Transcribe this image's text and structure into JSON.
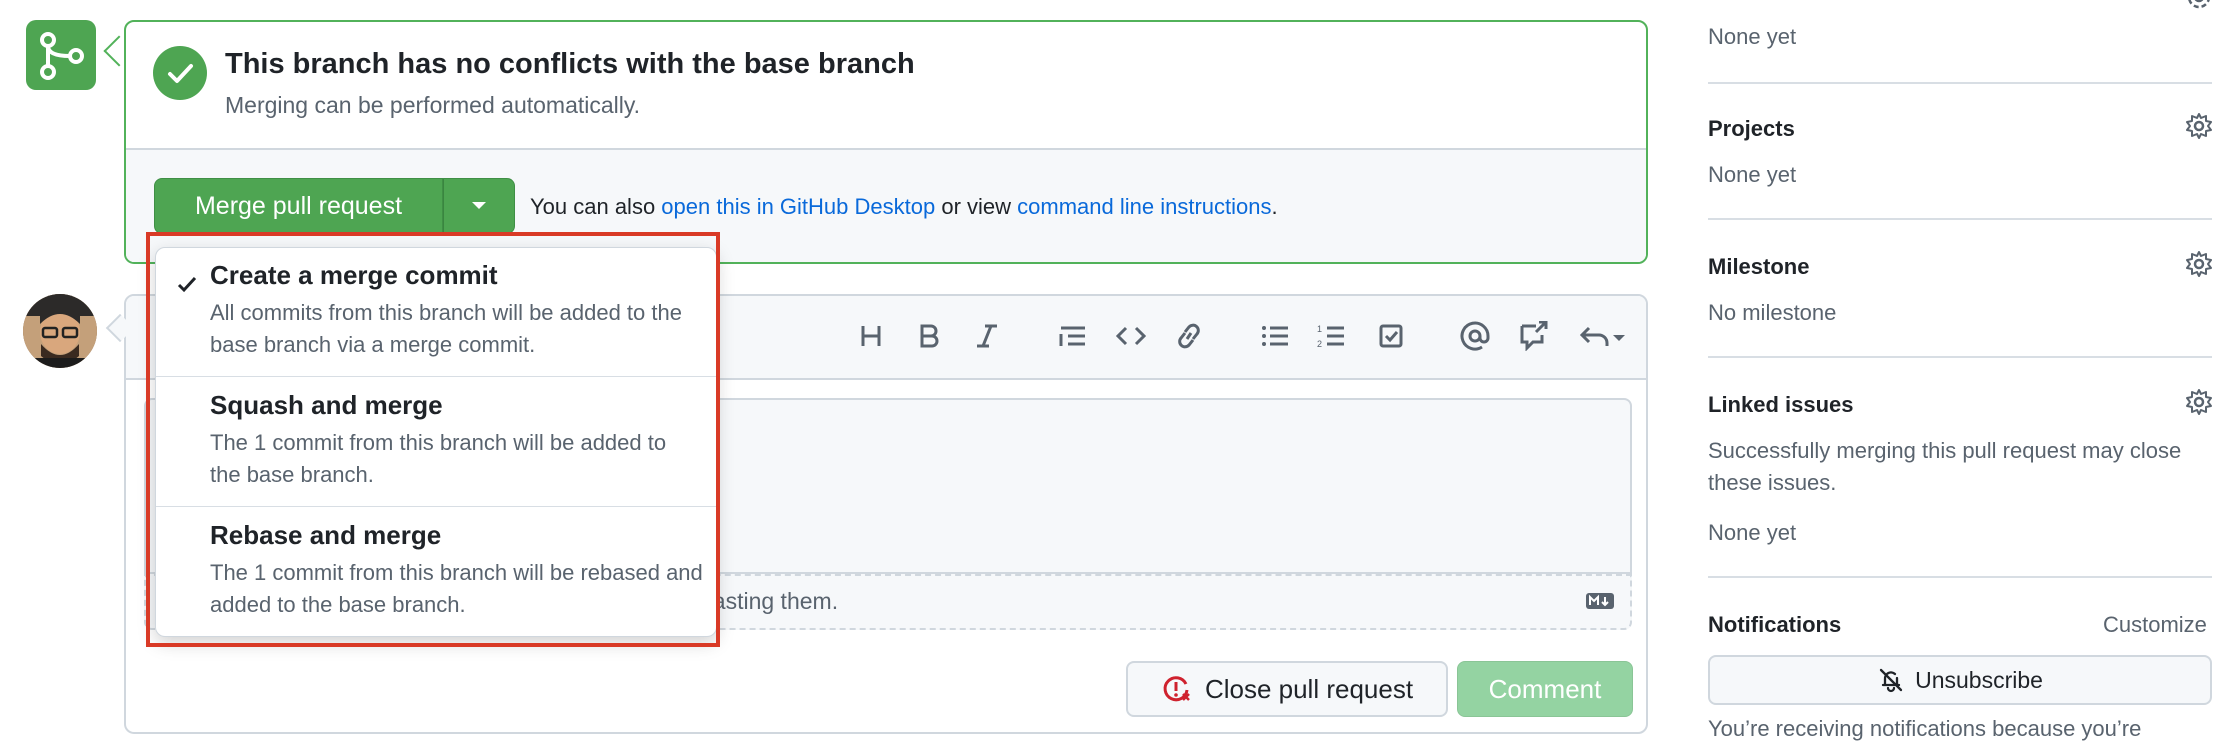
{
  "merge_status": {
    "title": "This branch has no conflicts with the base branch",
    "subtitle": "Merging can be performed automatically."
  },
  "merge_actions": {
    "merge_button_label": "Merge pull request",
    "also_prefix": "You can also ",
    "desktop_link": "open this in GitHub Desktop",
    "or_view": " or view ",
    "cli_link": "command line instructions",
    "period": "."
  },
  "merge_options": [
    {
      "title": "Create a merge commit",
      "desc": "All commits from this branch will be added to the base branch via a merge commit.",
      "selected": true
    },
    {
      "title": "Squash and merge",
      "desc": "The 1 commit from this branch will be added to the base branch.",
      "selected": false
    },
    {
      "title": "Rebase and merge",
      "desc": "The 1 commit from this branch will be rebased and added to the base branch.",
      "selected": false
    }
  ],
  "comment": {
    "attach_hint_partial": "pasting them.",
    "close_pr_label": "Close pull request",
    "comment_label": "Comment"
  },
  "sidebar": {
    "top_value": "None yet",
    "projects": {
      "label": "Projects",
      "value": "None yet"
    },
    "milestone": {
      "label": "Milestone",
      "value": "No milestone"
    },
    "linked_issues": {
      "label": "Linked issues",
      "desc_line1": "Successfully merging this pull request may close",
      "desc_line2": "these issues.",
      "value": "None yet"
    },
    "notifications": {
      "label": "Notifications",
      "customize": "Customize",
      "unsubscribe": "Unsubscribe",
      "reason": "You’re receiving notifications because you’re"
    }
  },
  "colors": {
    "merge_green": "#4ea552",
    "link_blue": "#0969da",
    "highlight_red": "#d93a26",
    "disabled_green": "#94d3a2"
  }
}
